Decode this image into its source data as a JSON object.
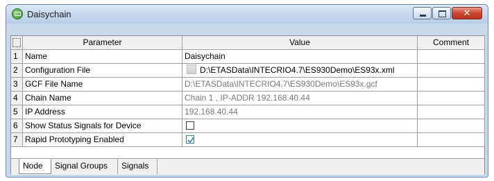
{
  "window": {
    "title": "Daisychain",
    "minimize": "",
    "maximize": "",
    "close": "✕"
  },
  "table": {
    "headers": {
      "parameter": "Parameter",
      "value": "Value",
      "comment": "Comment"
    },
    "rows": [
      {
        "index": "1",
        "parameter": "Name",
        "value": "Daisychain",
        "comment": "",
        "kind": "text",
        "enabled": true
      },
      {
        "index": "2",
        "parameter": "Configuration File",
        "value": "D:\\ETASData\\INTECRIO4.7\\ES930Demo\\ES93x.xml",
        "comment": "",
        "kind": "file",
        "enabled": true
      },
      {
        "index": "3",
        "parameter": "GCF File Name",
        "value": "D:\\ETASData\\INTECRIO4.7\\ES930Demo\\ES93x.gcf",
        "comment": "",
        "kind": "text",
        "enabled": false
      },
      {
        "index": "4",
        "parameter": "Chain Name",
        "value": "Chain 1  ,  IP-ADDR 192.168.40.44",
        "comment": "",
        "kind": "text",
        "enabled": false
      },
      {
        "index": "5",
        "parameter": "IP Address",
        "value": "192.168.40.44",
        "comment": "",
        "kind": "text",
        "enabled": false
      },
      {
        "index": "6",
        "parameter": "Show Status Signals for Device",
        "value": "",
        "comment": "",
        "kind": "checkbox",
        "checked": false
      },
      {
        "index": "7",
        "parameter": "Rapid Prototyping Enabled",
        "value": "",
        "comment": "",
        "kind": "checkbox",
        "checked": true
      }
    ]
  },
  "tabs": [
    {
      "label": "Node",
      "active": true
    },
    {
      "label": "Signal Groups",
      "active": false
    },
    {
      "label": "Signals",
      "active": false
    }
  ]
}
